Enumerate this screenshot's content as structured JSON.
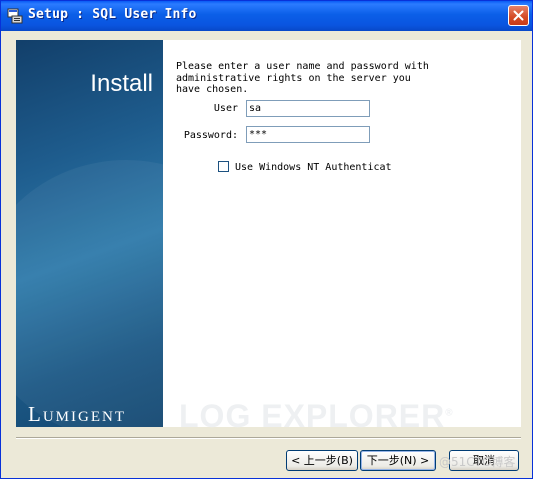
{
  "window": {
    "title": "Setup : SQL User Info"
  },
  "banner": {
    "heading": "Install",
    "brand": "Lumigent",
    "product": "LOG EXPLORER",
    "mark": "®"
  },
  "form": {
    "prompt": "Please enter a user name and password with\nadministrative rights on the server you\nhave chosen.",
    "user_label": "User",
    "user_value": "sa",
    "password_label": "Password:",
    "password_value": "***",
    "nt_auth_label": "Use Windows NT Authenticat",
    "nt_auth_checked": false
  },
  "buttons": {
    "back": "< 上一步(B)",
    "next": "下一步(N) >",
    "cancel": "取消"
  },
  "watermark": "@51CTO博客",
  "colors": {
    "titlebar": "#0a55e0",
    "banner": "#1e5c8d",
    "close": "#d44a24"
  }
}
